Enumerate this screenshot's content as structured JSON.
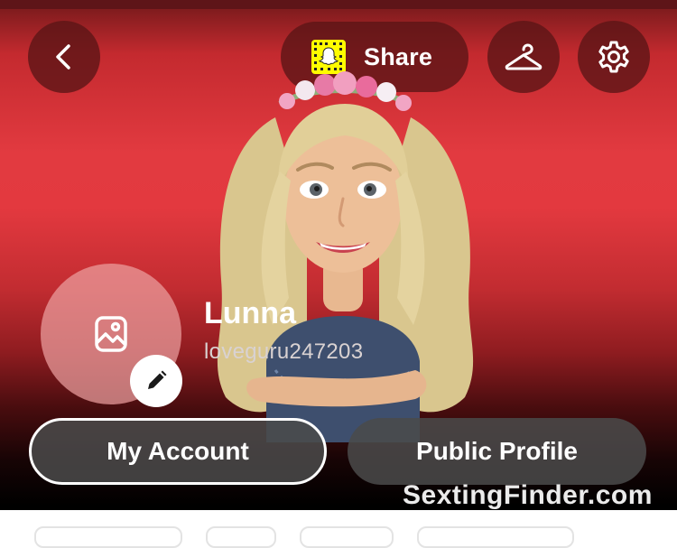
{
  "header": {
    "back_icon": "chevron-left-icon",
    "share_label": "Share",
    "snapcode_icon": "snapcode-icon",
    "outfit_icon": "hanger-icon",
    "settings_icon": "gear-icon"
  },
  "profile": {
    "display_name": "Lunna",
    "username": "loveguru247203",
    "photo_icon": "add-photo-icon",
    "edit_icon": "pencil-icon"
  },
  "actions": {
    "my_account_label": "My Account",
    "public_profile_label": "Public Profile"
  },
  "watermark": "SextingFinder.com",
  "colors": {
    "accent_red": "#e23a40",
    "snap_yellow": "#fffc00"
  }
}
